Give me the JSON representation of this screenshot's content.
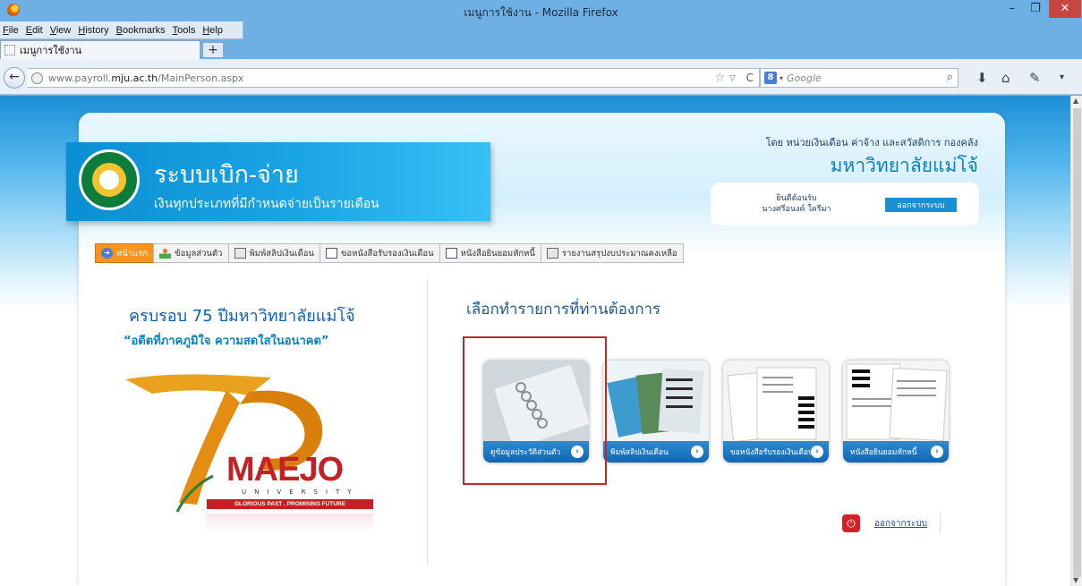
{
  "window": {
    "title": "เมนูการใช้งาน - Mozilla Firefox",
    "min": "–",
    "max": "❐",
    "close": "✕"
  },
  "menubar": {
    "items": [
      "File",
      "Edit",
      "View",
      "History",
      "Bookmarks",
      "Tools",
      "Help"
    ]
  },
  "tabs": {
    "active_title": "เมนูการใช้งาน",
    "new_tab": "+"
  },
  "navbar": {
    "url_host_prefix": "www.payroll.",
    "url_host_bold": "mju.ac.th",
    "url_path": "/MainPerson.aspx",
    "search_engine": "8",
    "search_placeholder": "Google"
  },
  "page": {
    "system_title": "ระบบเบิก-จ่าย",
    "system_subtitle": "เงินทุกประเภทที่มีกำหนดจ่ายเป็นรายเดือน",
    "byline": "โดย หน่วยเงินเดือน ค่าจ้าง และสวัสดิการ กองคลัง",
    "university": "มหาวิทยาลัยแม่โจ้",
    "welcome_line1": "ยินดีต้อนรับ",
    "welcome_line2": "นางศรีอนงค์ ใครีมา",
    "logout_button": "ออกจากระบบ",
    "nav_tabs": [
      {
        "label": "หน้าแรก",
        "icon": "home-icon"
      },
      {
        "label": "ข้อมูลส่วนตัว",
        "icon": "user-icon"
      },
      {
        "label": "พิมพ์สลิปเงินเดือน",
        "icon": "printer-icon"
      },
      {
        "label": "ขอหนังสือรับรองเงินเดือน",
        "icon": "document-icon"
      },
      {
        "label": "หนังสือยินยอมหักหนี้",
        "icon": "document-icon"
      },
      {
        "label": "รายงานสรุปงบประมาณคงเหลือ",
        "icon": "printer-icon"
      }
    ],
    "anniversary_title": "ครบรอบ 75 ปีมหาวิทยาลัยแม่โจ้",
    "anniversary_motto": "“อดีตที่ภาคภูมิใจ ความสดใสในอนาคต”",
    "logo_word": "MAEJO",
    "logo_univ": "UNIVERSITY",
    "logo_tagline": "GLORIOUS PAST . PROMISING FUTURE",
    "right_title": "เลือกทำรายการที่ท่านต้องการ",
    "cards": [
      {
        "label": "ดูข้อมูลประวัติส่วนตัว"
      },
      {
        "label": "พิมพ์สลิปเงินเดือน"
      },
      {
        "label": "ขอหนังสือรับรองเงินเดือน"
      },
      {
        "label": "หนังสือยินยอมหักหนี้"
      }
    ],
    "logout_link": "ออกจากระบบ",
    "accent_color": "#1a8fd4",
    "active_tab_color": "#f7941d",
    "highlight_color": "#c0282b"
  }
}
